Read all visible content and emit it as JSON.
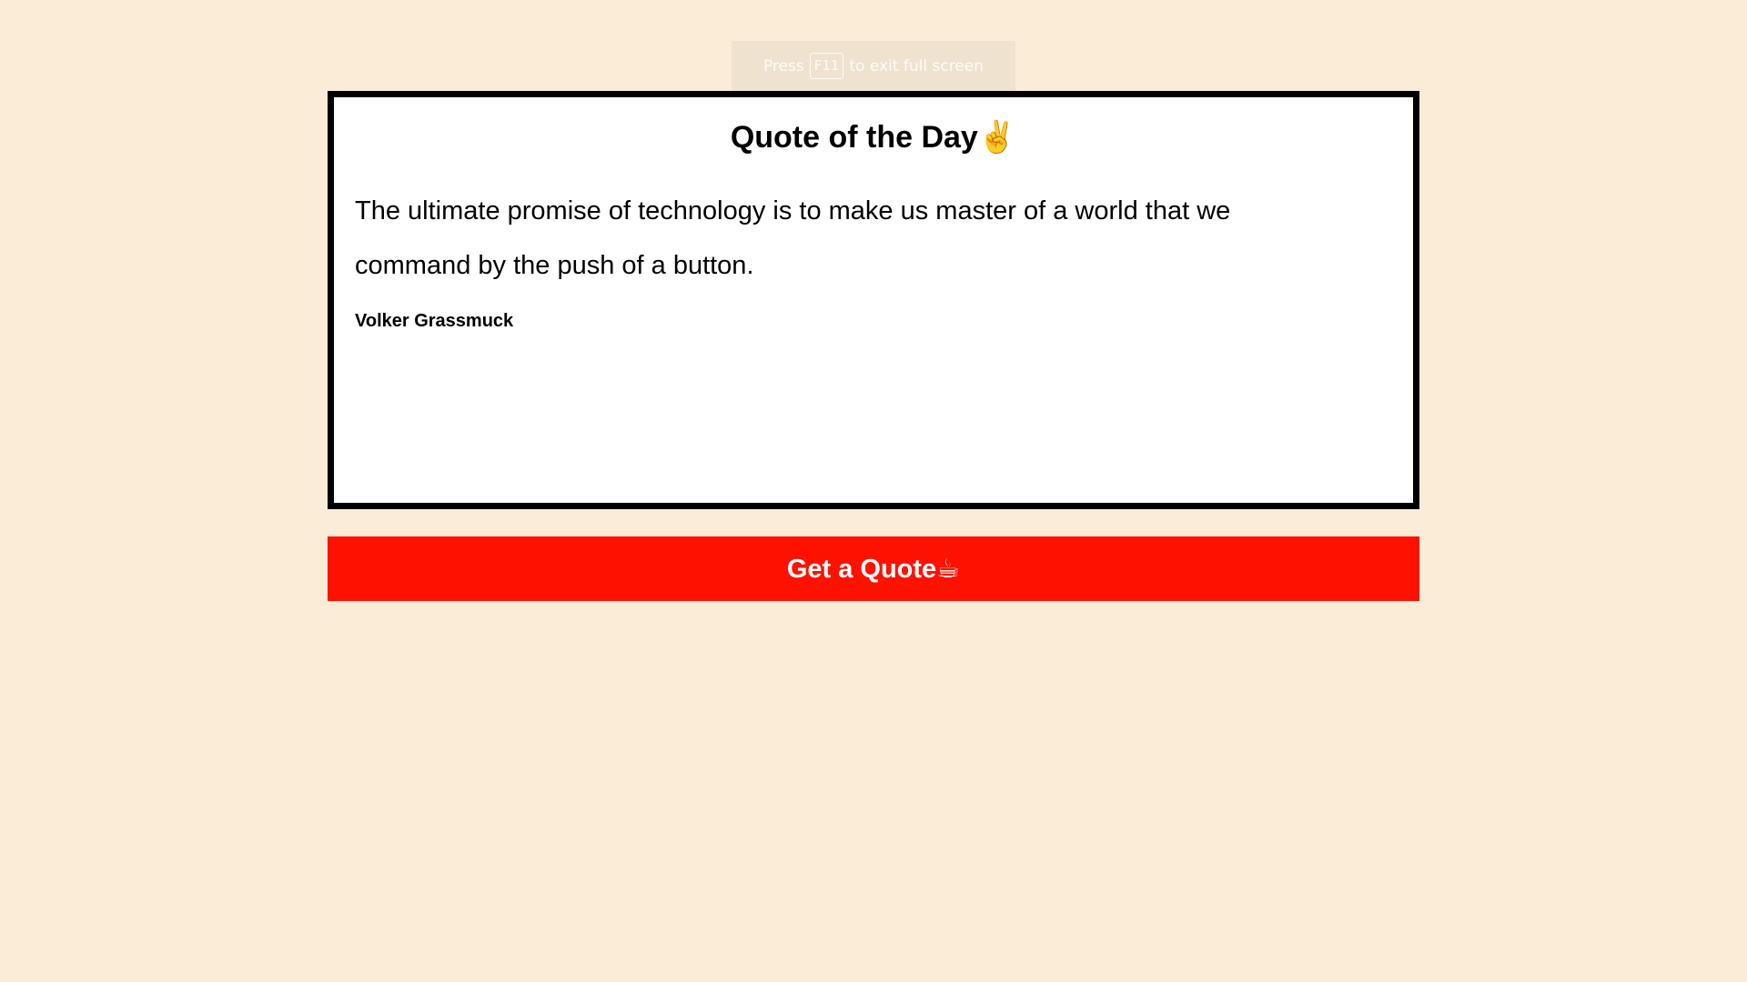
{
  "fullscreen_notice": {
    "prefix": "Press",
    "key": "F11",
    "suffix": "to exit full screen"
  },
  "card": {
    "title": "Quote of the Day✌️",
    "quote": "The ultimate promise of technology is to make us master of a world that we command by the push of a button.",
    "author": "Volker Grassmuck"
  },
  "button": {
    "label": "Get a Quote☕"
  },
  "colors": {
    "background": "#fbecd7",
    "card_border": "#000000",
    "button": "#ff1100"
  }
}
